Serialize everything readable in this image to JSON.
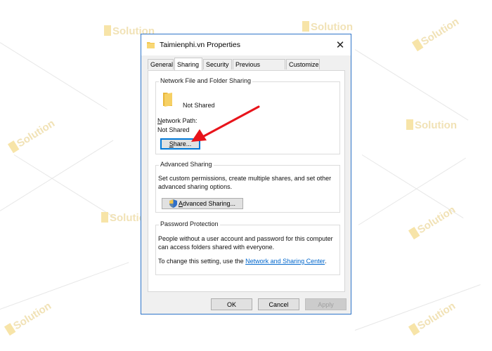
{
  "watermark": {
    "brand": "Solution"
  },
  "dialog": {
    "title": "Taimienphi.vn Properties",
    "close_glyph": "✕",
    "tabs": [
      {
        "label": "General"
      },
      {
        "label": "Sharing"
      },
      {
        "label": "Security"
      },
      {
        "label": "Previous Versions"
      },
      {
        "label": "Customize"
      }
    ],
    "network_sharing": {
      "title": "Network File and Folder Sharing",
      "folder_status": "Not Shared",
      "path_label_first": "N",
      "path_label_rest": "etwork Path:",
      "path_value": "Not Shared",
      "share_first": "S",
      "share_rest": "hare..."
    },
    "advanced_sharing": {
      "title": "Advanced Sharing",
      "desc_line1": "Set custom permissions, create multiple shares, and set other",
      "desc_line2": "advanced sharing options.",
      "button_first": "A",
      "button_rest": "dvanced Sharing..."
    },
    "password_protection": {
      "title": "Password Protection",
      "desc_line1": "People without a user account and password for this computer",
      "desc_line2": "can access folders shared with everyone.",
      "change_prefix": "To change this setting, use the ",
      "link_text": "Network and Sharing Center",
      "change_suffix": "."
    },
    "footer": {
      "ok": "OK",
      "cancel": "Cancel",
      "apply": "Apply"
    }
  },
  "colors": {
    "arrow": "#e8141b",
    "accent": "#0078d7",
    "folder": "#f3c64d"
  }
}
